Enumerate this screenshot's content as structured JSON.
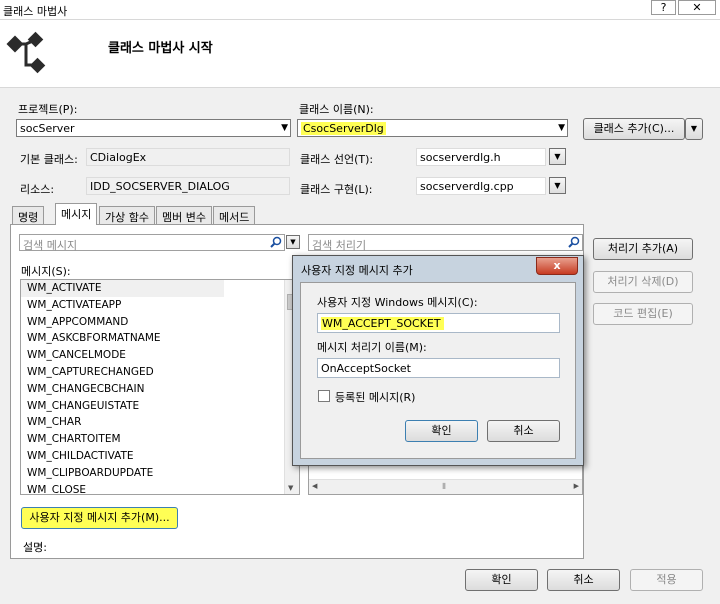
{
  "window": {
    "title": "클래스 마법사",
    "help_label": "?",
    "close_label": "✕"
  },
  "header": {
    "heading": "클래스 마법사 시작"
  },
  "project": {
    "label": "프로젝트(P):",
    "value": "socServer"
  },
  "class_name": {
    "label": "클래스 이름(N):",
    "value": "CsocServerDlg"
  },
  "add_class_button": "클래스 추가(C)...",
  "base_class": {
    "label": "기본 클래스:",
    "value": "CDialogEx"
  },
  "class_declaration": {
    "label": "클래스 선언(T):",
    "value": "socserverdlg.h"
  },
  "resource": {
    "label": "리소스:",
    "value": "IDD_SOCSERVER_DIALOG"
  },
  "class_implementation": {
    "label": "클래스 구현(L):",
    "value": "socserverdlg.cpp"
  },
  "tabs": [
    "명령",
    "메시지",
    "가상 함수",
    "멤버 변수",
    "메서드"
  ],
  "messages": {
    "search_placeholder": "검색 메시지",
    "label": "메시지(S):",
    "items": [
      "WM_ACTIVATE",
      "WM_ACTIVATEAPP",
      "WM_APPCOMMAND",
      "WM_ASKCBFORMATNAME",
      "WM_CANCELMODE",
      "WM_CAPTURECHANGED",
      "WM_CHANGECBCHAIN",
      "WM_CHANGEUISTATE",
      "WM_CHAR",
      "WM_CHARTOITEM",
      "WM_CHILDACTIVATE",
      "WM_CLIPBOARDUPDATE",
      "WM_CLOSE"
    ]
  },
  "handlers": {
    "search_placeholder": "검색 처리기"
  },
  "side_buttons": {
    "add_handler": "처리기 추가(A)",
    "delete_handler": "처리기 삭제(D)",
    "edit_code": "코드 편집(E)"
  },
  "add_custom_message_button": "사용자 지정 메시지 추가(M)...",
  "description_label": "설명:",
  "footer": {
    "ok": "확인",
    "cancel": "취소",
    "apply": "적용"
  },
  "dialog": {
    "title": "사용자 지정 메시지 추가",
    "windows_message_label": "사용자 지정 Windows 메시지(C):",
    "windows_message_value": "WM_ACCEPT_SOCKET",
    "handler_name_label": "메시지 처리기 이름(M):",
    "handler_name_value": "OnAcceptSocket",
    "registered_label": "등록된 메시지(R)",
    "registered_checked": false,
    "ok": "확인",
    "cancel": "취소",
    "close_label": "x"
  },
  "colors": {
    "highlight": "#ffff55",
    "dialog_frame": "#c7d3df",
    "close_button": "#c73b22"
  }
}
